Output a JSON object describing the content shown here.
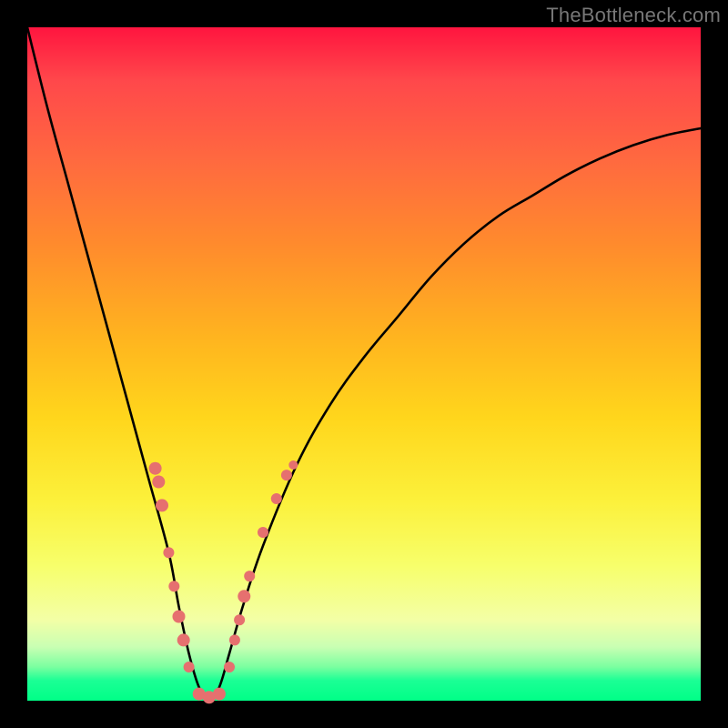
{
  "watermark": "TheBottleneck.com",
  "colors": {
    "frame": "#000000",
    "curve": "#000000",
    "marker_fill": "#e6706f",
    "marker_stroke": "#c14f4f"
  },
  "chart_data": {
    "type": "line",
    "title": "",
    "xlabel": "",
    "ylabel": "",
    "xlim": [
      0,
      100
    ],
    "ylim": [
      0,
      100
    ],
    "grid": false,
    "legend": false,
    "annotations": [
      "TheBottleneck.com"
    ],
    "series": [
      {
        "name": "bottleneck-curve",
        "x": [
          0,
          3,
          6,
          9,
          12,
          15,
          18,
          21,
          22.5,
          24,
          25.5,
          27,
          28.5,
          30,
          32,
          35,
          40,
          45,
          50,
          55,
          60,
          65,
          70,
          75,
          80,
          85,
          90,
          95,
          100
        ],
        "y": [
          100,
          88,
          77,
          66,
          55,
          44,
          33,
          22,
          14,
          7,
          2,
          0,
          2,
          7,
          14,
          23,
          35,
          44,
          51,
          57,
          63,
          68,
          72,
          75,
          78,
          80.5,
          82.5,
          84,
          85
        ]
      }
    ],
    "markers": [
      {
        "x": 19.0,
        "y": 34.5,
        "r": 7
      },
      {
        "x": 19.5,
        "y": 32.5,
        "r": 7
      },
      {
        "x": 20.0,
        "y": 29.0,
        "r": 7
      },
      {
        "x": 21.0,
        "y": 22.0,
        "r": 6
      },
      {
        "x": 21.8,
        "y": 17.0,
        "r": 6
      },
      {
        "x": 22.5,
        "y": 12.5,
        "r": 7
      },
      {
        "x": 23.2,
        "y": 9.0,
        "r": 7
      },
      {
        "x": 24.0,
        "y": 5.0,
        "r": 6
      },
      {
        "x": 25.5,
        "y": 1.0,
        "r": 7
      },
      {
        "x": 27.0,
        "y": 0.5,
        "r": 7
      },
      {
        "x": 28.5,
        "y": 1.0,
        "r": 7
      },
      {
        "x": 30.0,
        "y": 5.0,
        "r": 6
      },
      {
        "x": 30.8,
        "y": 9.0,
        "r": 6
      },
      {
        "x": 31.5,
        "y": 12.0,
        "r": 6
      },
      {
        "x": 32.2,
        "y": 15.5,
        "r": 7
      },
      {
        "x": 33.0,
        "y": 18.5,
        "r": 6
      },
      {
        "x": 35.0,
        "y": 25.0,
        "r": 6
      },
      {
        "x": 37.0,
        "y": 30.0,
        "r": 6
      },
      {
        "x": 38.5,
        "y": 33.5,
        "r": 6
      },
      {
        "x": 39.5,
        "y": 35.0,
        "r": 5
      }
    ]
  }
}
